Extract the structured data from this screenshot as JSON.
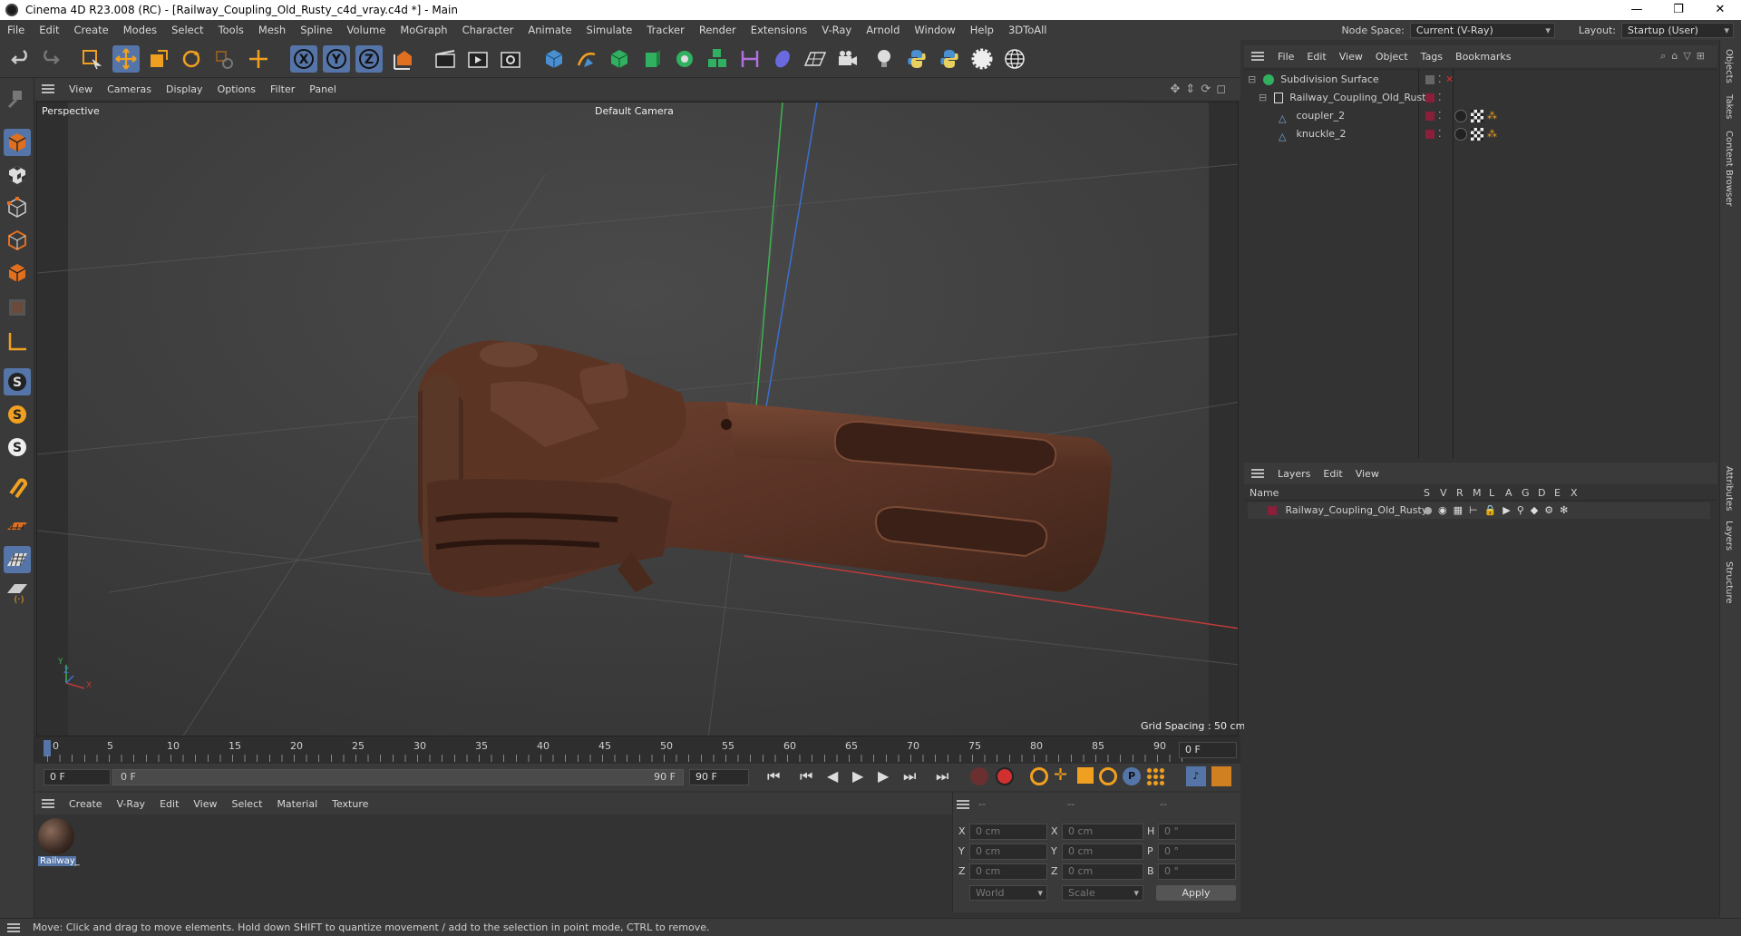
{
  "window": {
    "title": "Cinema 4D R23.008 (RC) - [Railway_Coupling_Old_Rusty_c4d_vray.c4d *] - Main",
    "minimize": "—",
    "maximize": "❐",
    "close": "✕"
  },
  "menubar": {
    "items": [
      "File",
      "Edit",
      "Create",
      "Modes",
      "Select",
      "Tools",
      "Mesh",
      "Spline",
      "Volume",
      "MoGraph",
      "Character",
      "Animate",
      "Simulate",
      "Tracker",
      "Render",
      "Extensions",
      "V-Ray",
      "Arnold",
      "Window",
      "Help",
      "3DToAll"
    ],
    "node_space_label": "Node Space:",
    "node_space_value": "Current (V-Ray)",
    "layout_label": "Layout:",
    "layout_value": "Startup (User)"
  },
  "viewport": {
    "menu": [
      "View",
      "Cameras",
      "Display",
      "Options",
      "Filter",
      "Panel"
    ],
    "view_name": "Perspective",
    "camera": "Default Camera",
    "grid_spacing": "Grid Spacing : 50 cm",
    "axis_y": "Y",
    "axis_z": "Z",
    "axis_x": "X"
  },
  "timeline": {
    "ticks": [
      "0",
      "5",
      "10",
      "15",
      "20",
      "25",
      "30",
      "35",
      "40",
      "45",
      "50",
      "55",
      "60",
      "65",
      "70",
      "75",
      "80",
      "85",
      "90"
    ],
    "current_frame": "0 F",
    "start_field": "0 F",
    "range_start": "0 F",
    "range_end": "90 F",
    "end_field": "90 F"
  },
  "materials": {
    "menu": [
      "Create",
      "V-Ray",
      "Edit",
      "View",
      "Select",
      "Material",
      "Texture"
    ],
    "items": [
      {
        "name": "Railway_"
      }
    ]
  },
  "coordinates": {
    "headers": [
      "--",
      "--",
      "--"
    ],
    "rows": [
      {
        "a": "X",
        "av": "0 cm",
        "b": "X",
        "bv": "0 cm",
        "c": "H",
        "cv": "0 °"
      },
      {
        "a": "Y",
        "av": "0 cm",
        "b": "Y",
        "bv": "0 cm",
        "c": "P",
        "cv": "0 °"
      },
      {
        "a": "Z",
        "av": "0 cm",
        "b": "Z",
        "bv": "0 cm",
        "c": "B",
        "cv": "0 °"
      }
    ],
    "mode1": "World",
    "mode2": "Scale",
    "apply": "Apply"
  },
  "objects": {
    "menu": [
      "File",
      "Edit",
      "View",
      "Object",
      "Tags",
      "Bookmarks"
    ],
    "tree": [
      {
        "name": "Subdivision Surface",
        "level": 0
      },
      {
        "name": "Railway_Coupling_Old_Rusty",
        "level": 1
      },
      {
        "name": "coupler_2",
        "level": 2
      },
      {
        "name": "knuckle_2",
        "level": 2
      }
    ]
  },
  "layers": {
    "menu": [
      "Layers",
      "Edit",
      "View"
    ],
    "col_name": "Name",
    "cols": [
      "S",
      "V",
      "R",
      "M",
      "L",
      "A",
      "G",
      "D",
      "E",
      "X"
    ],
    "items": [
      {
        "name": "Railway_Coupling_Old_Rusty"
      }
    ]
  },
  "sidetabs": [
    "Objects",
    "Takes",
    "Content Browser",
    "Attributes",
    "Layers",
    "Structure"
  ],
  "status": "Move: Click and drag to move elements. Hold down SHIFT to quantize movement / add to the selection in point mode, CTRL to remove.",
  "colors": {
    "accent": "#4a7fd0",
    "layer_color": "#8a1f3a",
    "rust": "#6b3a24"
  }
}
